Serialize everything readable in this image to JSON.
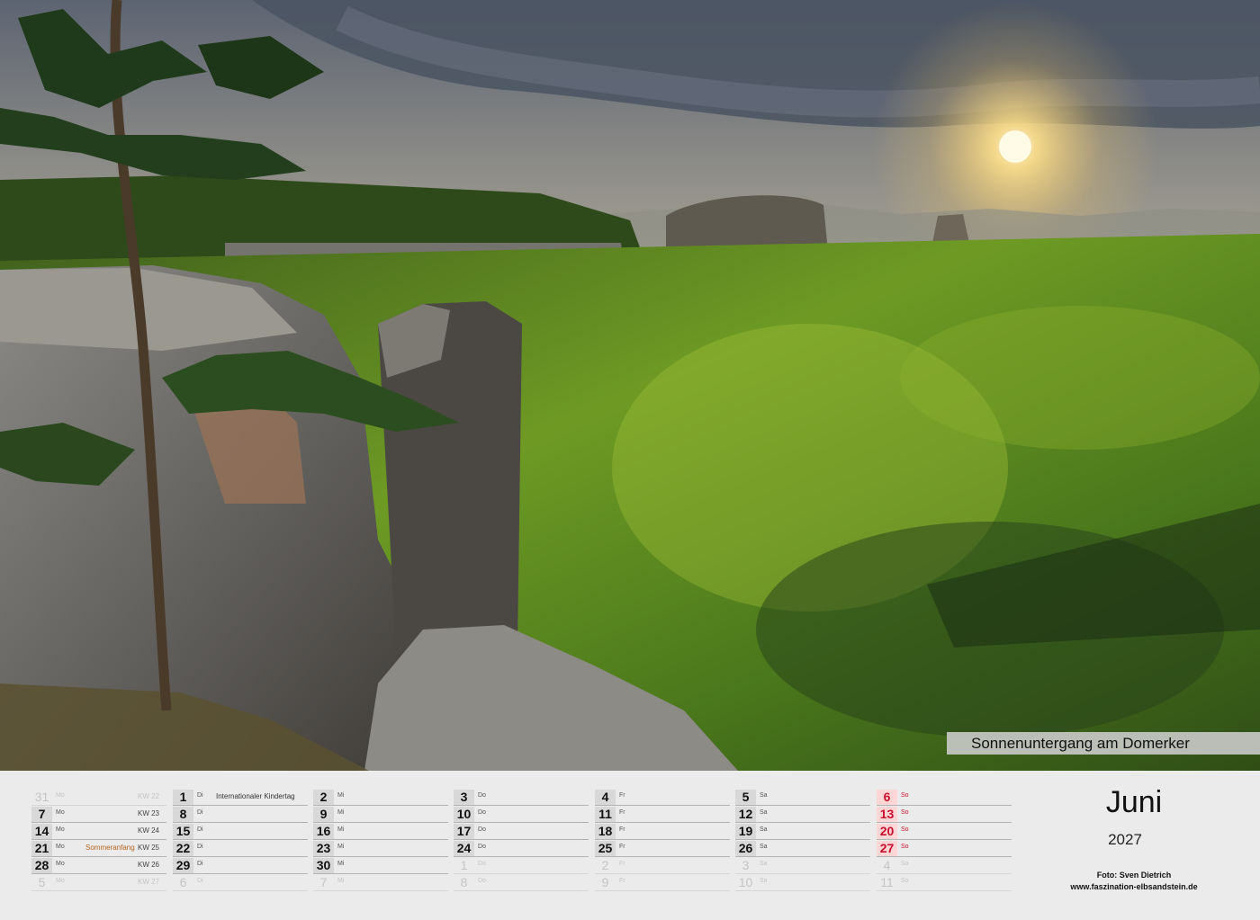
{
  "caption": "Sonnenuntergang am Domerker",
  "month": "Juni",
  "year": "2027",
  "photo_credit": "Foto: Sven Dietrich",
  "website": "www.faszination-elbsandstein.de",
  "columns": [
    [
      {
        "n": "31",
        "wd": "Mo",
        "kw": "KW 22",
        "faded": true
      },
      {
        "n": "7",
        "wd": "Mo",
        "kw": "KW 23"
      },
      {
        "n": "14",
        "wd": "Mo",
        "kw": "KW 24"
      },
      {
        "n": "21",
        "wd": "Mo",
        "kw": "KW 25",
        "note": "Sommeranfang"
      },
      {
        "n": "28",
        "wd": "Mo",
        "kw": "KW 26"
      },
      {
        "n": "5",
        "wd": "Mo",
        "kw": "KW 27",
        "faded": true
      }
    ],
    [
      {
        "n": "1",
        "wd": "Di",
        "note": "Internationaler Kindertag"
      },
      {
        "n": "8",
        "wd": "Di"
      },
      {
        "n": "15",
        "wd": "Di"
      },
      {
        "n": "22",
        "wd": "Di"
      },
      {
        "n": "29",
        "wd": "Di"
      },
      {
        "n": "6",
        "wd": "Di",
        "faded": true
      }
    ],
    [
      {
        "n": "2",
        "wd": "Mi"
      },
      {
        "n": "9",
        "wd": "Mi"
      },
      {
        "n": "16",
        "wd": "Mi"
      },
      {
        "n": "23",
        "wd": "Mi"
      },
      {
        "n": "30",
        "wd": "Mi"
      },
      {
        "n": "7",
        "wd": "Mi",
        "faded": true
      }
    ],
    [
      {
        "n": "3",
        "wd": "Do"
      },
      {
        "n": "10",
        "wd": "Do"
      },
      {
        "n": "17",
        "wd": "Do"
      },
      {
        "n": "24",
        "wd": "Do"
      },
      {
        "n": "1",
        "wd": "Do",
        "faded": true
      },
      {
        "n": "8",
        "wd": "Do",
        "faded": true
      }
    ],
    [
      {
        "n": "4",
        "wd": "Fr"
      },
      {
        "n": "11",
        "wd": "Fr"
      },
      {
        "n": "18",
        "wd": "Fr"
      },
      {
        "n": "25",
        "wd": "Fr"
      },
      {
        "n": "2",
        "wd": "Fr",
        "faded": true
      },
      {
        "n": "9",
        "wd": "Fr",
        "faded": true
      }
    ],
    [
      {
        "n": "5",
        "wd": "Sa"
      },
      {
        "n": "12",
        "wd": "Sa"
      },
      {
        "n": "19",
        "wd": "Sa"
      },
      {
        "n": "26",
        "wd": "Sa"
      },
      {
        "n": "3",
        "wd": "Sa",
        "faded": true
      },
      {
        "n": "10",
        "wd": "Sa",
        "faded": true
      }
    ],
    [
      {
        "n": "6",
        "wd": "So",
        "sun": true
      },
      {
        "n": "13",
        "wd": "So",
        "sun": true
      },
      {
        "n": "20",
        "wd": "So",
        "sun": true
      },
      {
        "n": "27",
        "wd": "So",
        "sun": true
      },
      {
        "n": "4",
        "wd": "So",
        "faded": true
      },
      {
        "n": "11",
        "wd": "So",
        "faded": true
      }
    ]
  ]
}
